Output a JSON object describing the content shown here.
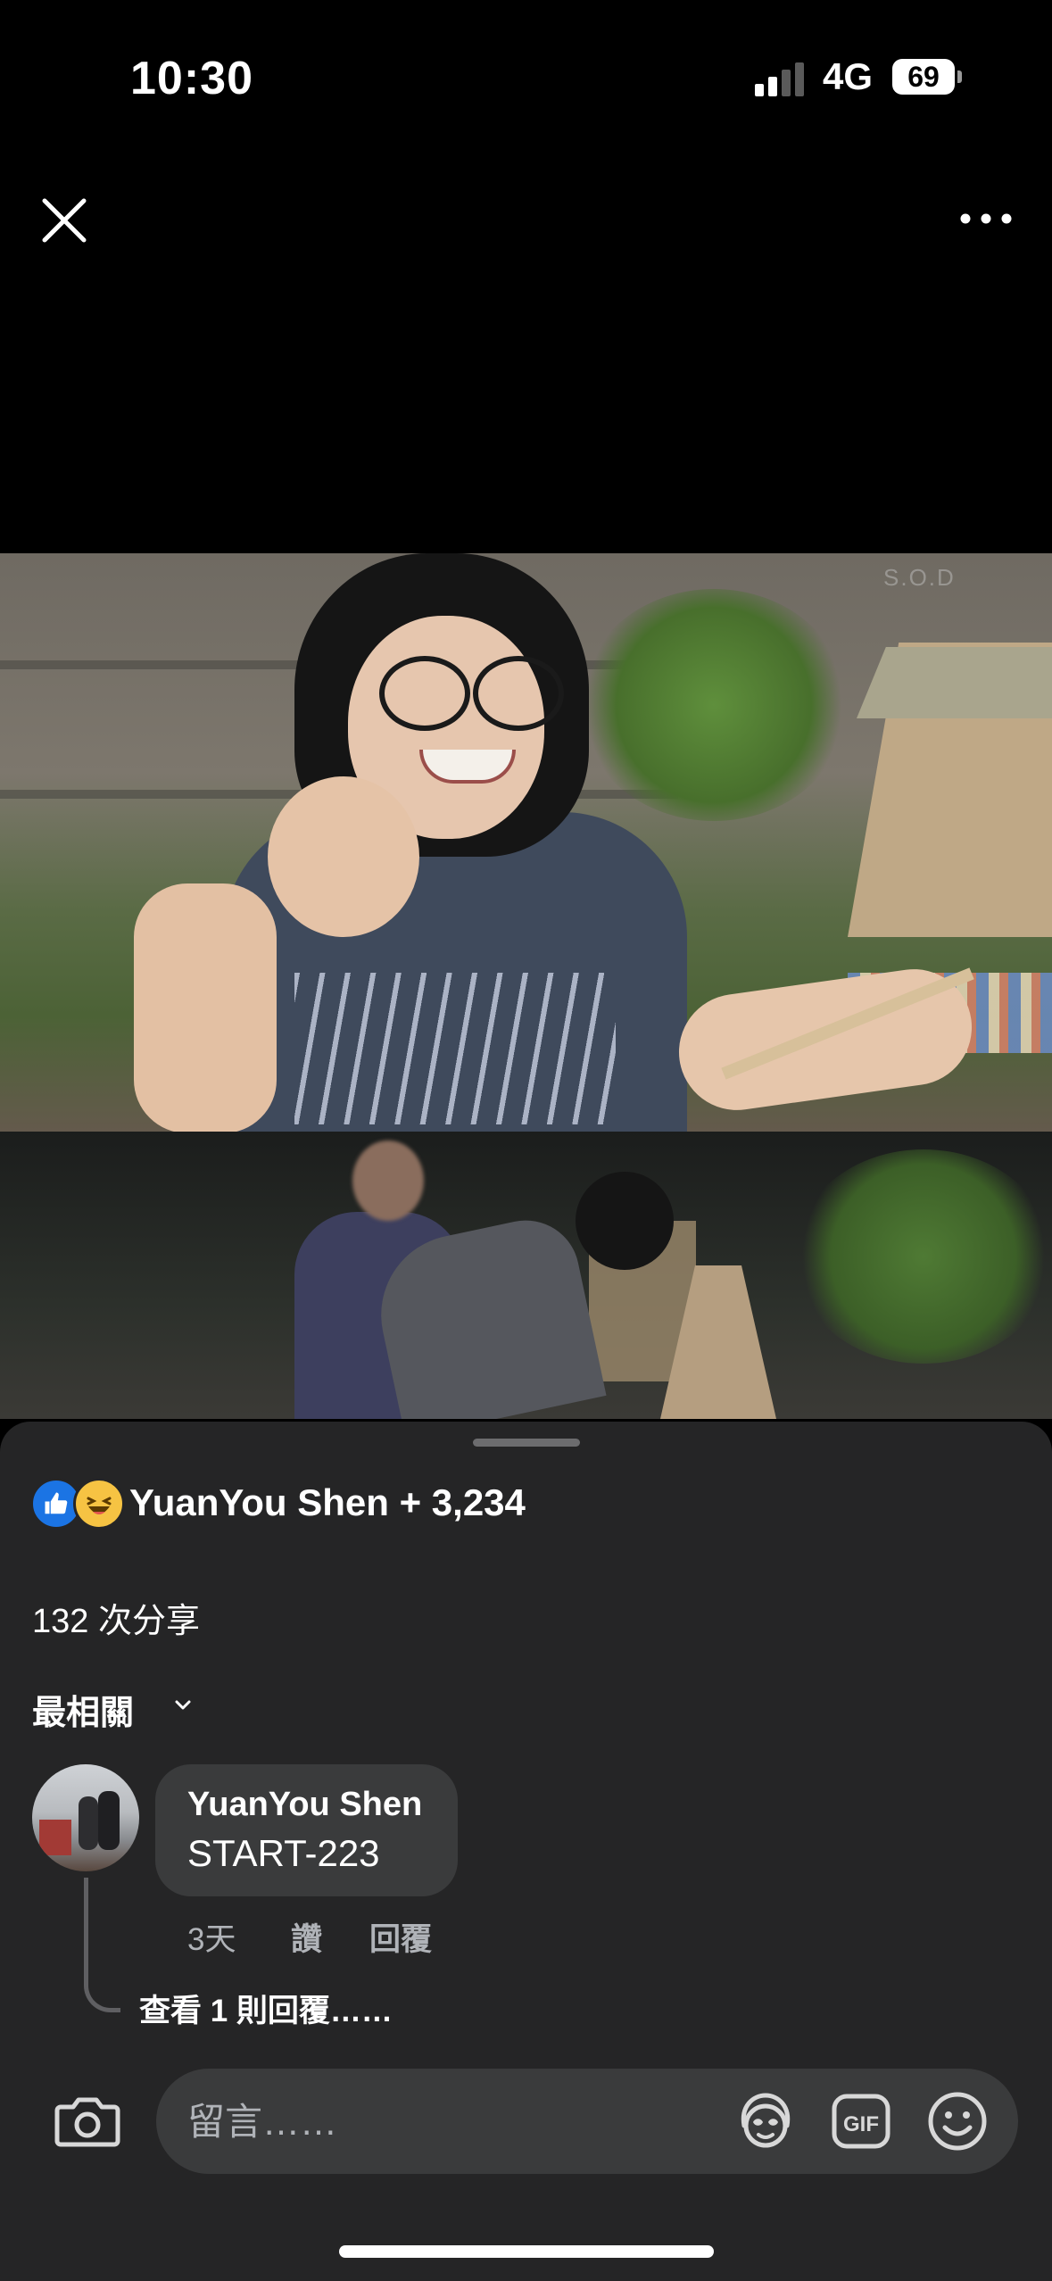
{
  "status_bar": {
    "time": "10:30",
    "network": "4G",
    "battery": "69"
  },
  "top_controls": {
    "close_icon": "close-icon",
    "more_icon": "more-horizontal-icon"
  },
  "video": {
    "watermark": "S.O.D"
  },
  "reactions": {
    "types": [
      "like",
      "haha"
    ],
    "summary": "YuanYou Shen + 3,234"
  },
  "shares": "132 次分享",
  "sort": {
    "label": "最相關"
  },
  "comments": [
    {
      "author": "YuanYou Shen",
      "text": "START-223",
      "time": "3天",
      "like_label": "讚",
      "reply_label": "回覆",
      "view_replies": "查看 1 則回覆……"
    }
  ],
  "composer": {
    "placeholder": "留言……",
    "gif_label": "GIF"
  },
  "colors": {
    "sheet": "#252526",
    "bubble": "#3a3b3c",
    "like_blue": "#1b74e4",
    "haha_yellow": "#f6c343",
    "secondary_text": "#b0b3b8"
  }
}
